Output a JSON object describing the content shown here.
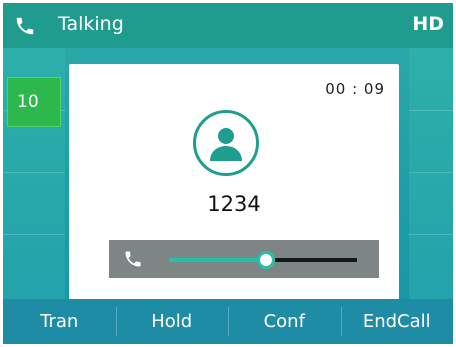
{
  "header": {
    "status": "Talking",
    "hd_label": "HD"
  },
  "line_key": {
    "label": "10"
  },
  "call": {
    "timer": "00 : 09",
    "number": "1234"
  },
  "volume": {
    "level_fraction": 0.5
  },
  "softkeys": [
    {
      "label": "Tran"
    },
    {
      "label": "Hold"
    },
    {
      "label": "Conf"
    },
    {
      "label": "EndCall"
    }
  ],
  "colors": {
    "accent": "#1f9c8d",
    "line_key_active": "#2db84c",
    "softkey_bar": "#1f8ca6"
  }
}
